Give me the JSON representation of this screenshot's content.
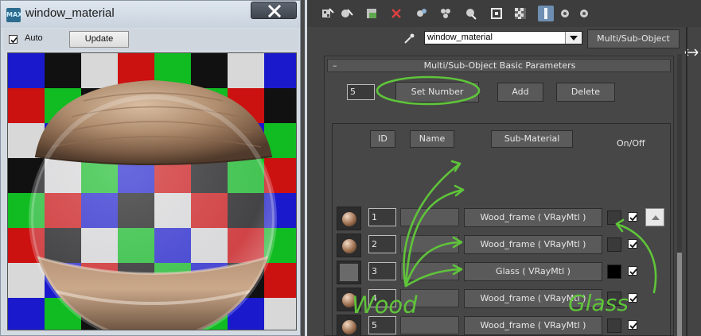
{
  "preview_window": {
    "app_icon_text": "MAX",
    "title": "window_material",
    "auto_label": "Auto",
    "auto_checked": true,
    "update_label": "Update"
  },
  "editor": {
    "toolbar_icons": [
      "put-to-scene-icon",
      "assign-material-icon",
      "reset-map-icon",
      "delete-icon",
      "copy-material-icon",
      "make-unique-icon",
      "put-to-library-icon",
      "material-id-icon",
      "background-checker-icon",
      "show-map-icon",
      "go-to-parent-icon",
      "go-forward-icon"
    ],
    "material_name": "window_material",
    "material_type": "Multi/Sub-Object",
    "rollout": {
      "toggle": "–",
      "title": "Multi/Sub-Object Basic Parameters",
      "set_number_value": "5",
      "set_number_label": "Set Number",
      "add_label": "Add",
      "delete_label": "Delete",
      "columns": {
        "id": "ID",
        "name": "Name",
        "sub_material": "Sub-Material",
        "on_off": "On/Off"
      },
      "rows": [
        {
          "id": "1",
          "sub_material": "Wood_frame  ( VRayMtl )",
          "on": true,
          "swatch": "wood"
        },
        {
          "id": "2",
          "sub_material": "Wood_frame  ( VRayMtl )",
          "on": true,
          "swatch": "wood"
        },
        {
          "id": "3",
          "sub_material": "Glass  ( VRayMtl )",
          "on": true,
          "swatch": "plain"
        },
        {
          "id": "4",
          "sub_material": "Wood_frame  ( VRayMtl )",
          "on": true,
          "swatch": "wood"
        },
        {
          "id": "5",
          "sub_material": "Wood_frame  ( VRayMtl )",
          "on": true,
          "swatch": "wood"
        }
      ]
    }
  },
  "annotations": {
    "wood_label": "Wood",
    "glass_label": "Glass",
    "color": "#5fc43a"
  }
}
